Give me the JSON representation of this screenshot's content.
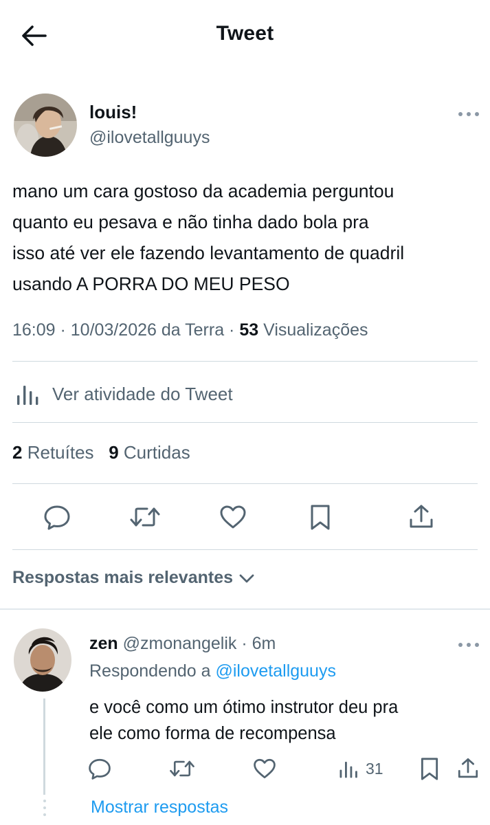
{
  "header": {
    "title": "Tweet"
  },
  "tweet": {
    "author_name": "louis!",
    "author_handle": "@ilovetallguuys",
    "text_lines": [
      "mano um cara gostoso da academia perguntou",
      "quanto eu pesava e não tinha dado bola pra",
      "isso até ver ele fazendo levantamento de quadril",
      "usando A PORRA DO MEU PESO"
    ],
    "time": "16:09",
    "date": "10/03/2026 da Terra",
    "views_count": "53",
    "views_label": "Visualizações",
    "activity_label": "Ver atividade do Tweet",
    "retweets_count": "2",
    "retweets_label": "Retuítes",
    "likes_count": "9",
    "likes_label": "Curtidas"
  },
  "replies_sort_label": "Respostas mais relevantes",
  "reply": {
    "name": "zen",
    "handle": "@zmonangelik",
    "time": "6m",
    "replying_prefix": "Respondendo a",
    "replying_to": "@ilovetallguuys",
    "text_lines": [
      "e você como um ótimo instrutor deu pra",
      "ele como forma de recompensa"
    ],
    "views_count": "31",
    "show_replies_label": "Mostrar respostas"
  },
  "icons": {
    "back": "arrow-left-icon",
    "more": "more-horizontal-icon",
    "activity": "bar-chart-icon",
    "reply": "speech-bubble-icon",
    "retweet": "retweet-icon",
    "like": "heart-icon",
    "bookmark": "bookmark-icon",
    "share": "share-icon",
    "sort": "chevron-down-icon"
  },
  "colors": {
    "text_primary": "#0f1419",
    "text_secondary": "#536471",
    "link": "#1d9bf0",
    "divider": "#cfd9de"
  }
}
